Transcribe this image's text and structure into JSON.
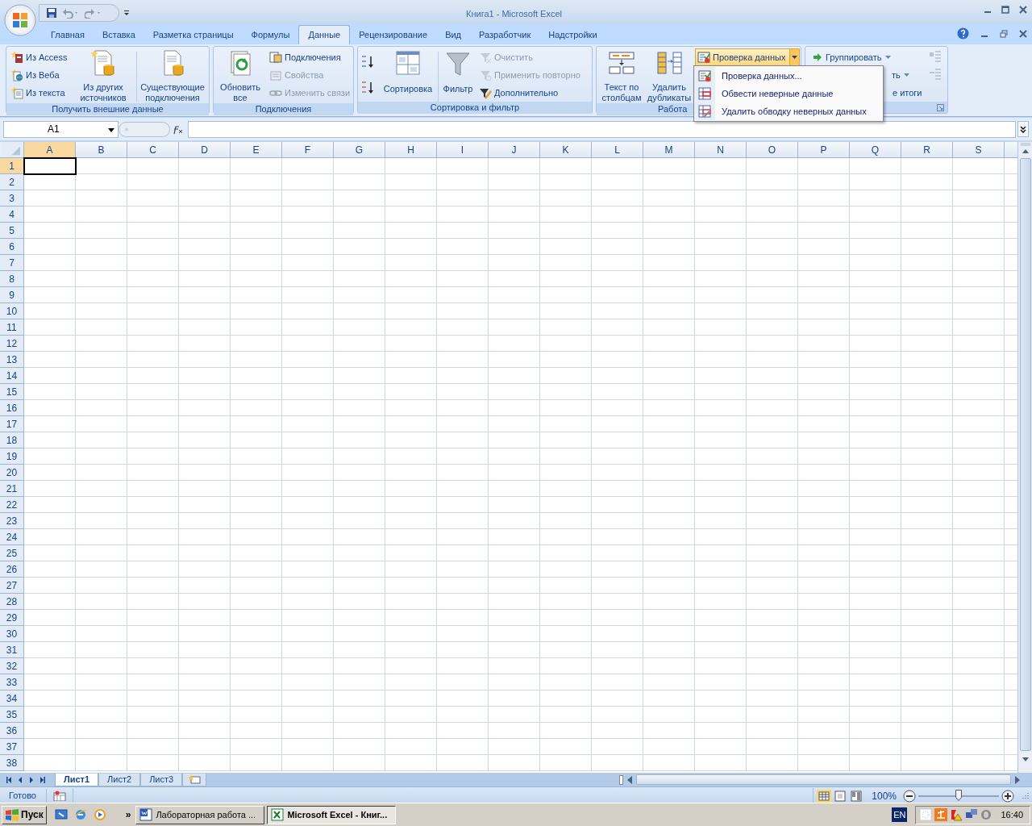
{
  "window": {
    "title": "Книга1 - Microsoft Excel"
  },
  "tabs": [
    {
      "label": "Главная",
      "selected": false
    },
    {
      "label": "Вставка",
      "selected": false
    },
    {
      "label": "Разметка страницы",
      "selected": false
    },
    {
      "label": "Формулы",
      "selected": false
    },
    {
      "label": "Данные",
      "selected": true
    },
    {
      "label": "Рецензирование",
      "selected": false
    },
    {
      "label": "Вид",
      "selected": false
    },
    {
      "label": "Разработчик",
      "selected": false
    },
    {
      "label": "Надстройки",
      "selected": false
    }
  ],
  "ribbon": {
    "get_external": {
      "label": "Получить внешние данные",
      "small": [
        {
          "label": "Из Access"
        },
        {
          "label": "Из Веба"
        },
        {
          "label": "Из текста"
        }
      ],
      "other_sources": "Из других источников",
      "existing": "Существующие подключения"
    },
    "connections": {
      "label": "Подключения",
      "refresh": "Обновить все",
      "small": [
        {
          "label": "Подключения",
          "disabled": false
        },
        {
          "label": "Свойства",
          "disabled": true
        },
        {
          "label": "Изменить связи",
          "disabled": true
        }
      ]
    },
    "sort_filter": {
      "label": "Сортировка и фильтр",
      "sort": "Сортировка",
      "filter": "Фильтр",
      "small": [
        {
          "label": "Очистить",
          "disabled": true
        },
        {
          "label": "Применить повторно",
          "disabled": true
        },
        {
          "label": "Дополнительно",
          "disabled": false
        }
      ]
    },
    "data_tools": {
      "label": "Работа",
      "text_to_columns": "Текст по столбцам",
      "remove_duplicates": "Удалить дубликаты",
      "validation": {
        "label": "Проверка данных",
        "highlighted": true
      }
    },
    "outline": {
      "group": "Группировать",
      "ungroup_fragment": "ть",
      "subtotal_fragment": "е итоги"
    }
  },
  "validation_menu": [
    {
      "label": "Проверка данных..."
    },
    {
      "label": "Обвести неверные данные"
    },
    {
      "label": "Удалить обводку неверных данных"
    }
  ],
  "formula_bar": {
    "name_box": "A1"
  },
  "columns": [
    "A",
    "B",
    "C",
    "D",
    "E",
    "F",
    "G",
    "H",
    "I",
    "J",
    "K",
    "L",
    "M",
    "N",
    "O",
    "P",
    "Q",
    "R",
    "S"
  ],
  "rows": [
    "1",
    "2",
    "3",
    "4",
    "5",
    "6",
    "7",
    "8",
    "9",
    "10",
    "11",
    "12",
    "13",
    "14",
    "15",
    "16",
    "17",
    "18",
    "19",
    "20",
    "21",
    "22",
    "23",
    "24",
    "25",
    "26",
    "27",
    "28",
    "29",
    "30",
    "31",
    "32",
    "33",
    "34",
    "35",
    "36",
    "37",
    "38"
  ],
  "sheets": [
    {
      "label": "Лист1",
      "selected": true
    },
    {
      "label": "Лист2",
      "selected": false
    },
    {
      "label": "Лист3",
      "selected": false
    }
  ],
  "status_bar": {
    "status": "Готово",
    "zoom": "100%",
    "zoom_level": {
      "level": 0.5
    }
  },
  "taskbar": {
    "start": "Пуск",
    "more": "»",
    "tasks": [
      {
        "label": "Лабораторная работа ...",
        "selected": false
      },
      {
        "label": "Microsoft Excel - Книг...",
        "selected": true
      }
    ],
    "language": "EN",
    "time": "16:40"
  }
}
